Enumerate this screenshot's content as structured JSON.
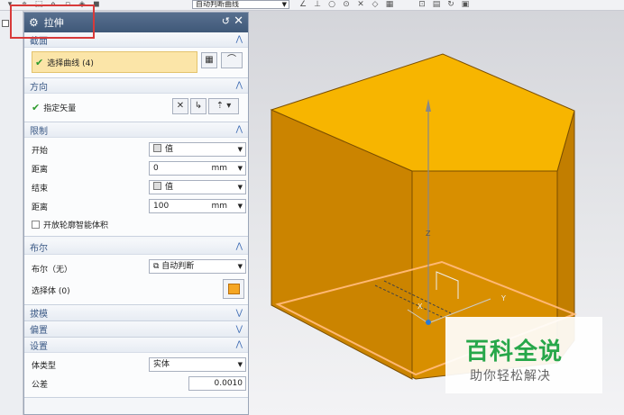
{
  "toolbar": {
    "curve_rule": "自动判断曲线"
  },
  "dialog": {
    "title": "拉伸",
    "section": {
      "header": "截面",
      "select_curve": "选择曲线 (4)"
    },
    "direction": {
      "header": "方向",
      "specify_vector": "指定矢量"
    },
    "limits": {
      "header": "限制",
      "start_label": "开始",
      "start_value": "值",
      "distance1_label": "距离",
      "distance1_value": "0",
      "distance1_unit": "mm",
      "end_label": "结束",
      "end_value": "值",
      "distance2_label": "距离",
      "distance2_value": "100",
      "distance2_unit": "mm",
      "open_profile": "开放轮廓智能体积"
    },
    "boolean": {
      "header": "布尔",
      "boolean_label": "布尔（无）",
      "boolean_value": "自动判断",
      "select_body": "选择体 (0)"
    },
    "draft": {
      "header": "拔模"
    },
    "offset": {
      "header": "偏置"
    },
    "settings": {
      "header": "设置",
      "body_type_label": "体类型",
      "body_type_value": "实体",
      "tolerance_label": "公差",
      "tolerance_value": "0.0010"
    }
  },
  "viewport": {
    "axis_z": "Z",
    "axis_y": "Y",
    "axis_x": "X",
    "cube_top_color": "#f7b500",
    "cube_front_color": "#d88f00",
    "cube_side_color": "#c27e00"
  },
  "watermark": {
    "title": "百科全说",
    "subtitle": "助你轻松解决"
  }
}
